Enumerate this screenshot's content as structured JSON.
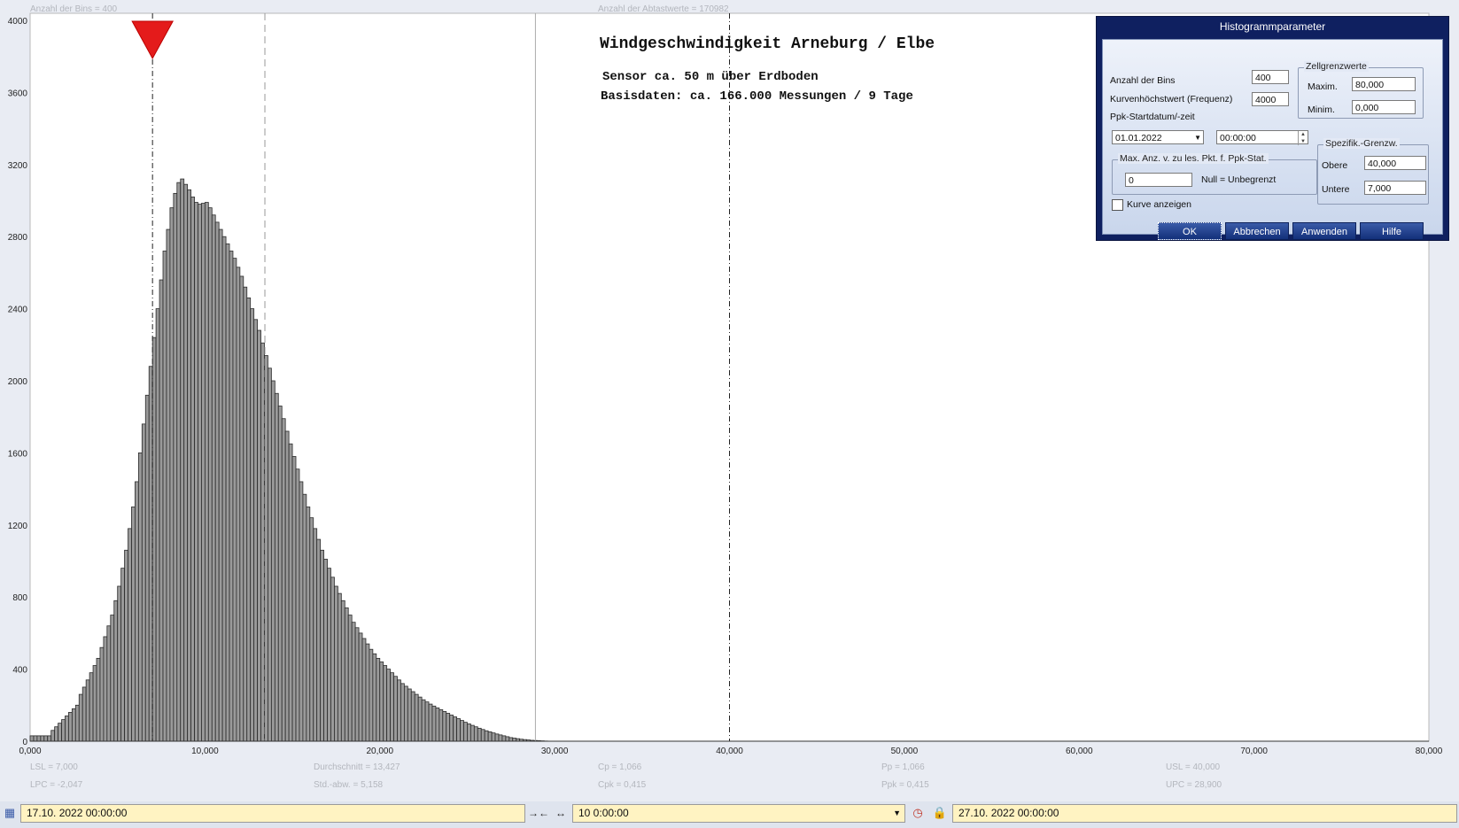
{
  "chart_data": {
    "type": "bar",
    "x_range": [
      0,
      80
    ],
    "ylim": [
      0,
      4000
    ],
    "x_ticks": [
      "0,000",
      "10,000",
      "20,000",
      "30,000",
      "40,000",
      "50,000",
      "60,000",
      "70,000",
      "80,000"
    ],
    "y_ticks": [
      "0",
      "400",
      "800",
      "1200",
      "1600",
      "2000",
      "2400",
      "2800",
      "3200",
      "3600",
      "4000"
    ],
    "bin_width": 0.2,
    "bin_start": 0,
    "values": [
      30,
      30,
      30,
      30,
      30,
      30,
      60,
      80,
      100,
      120,
      140,
      160,
      180,
      200,
      260,
      300,
      340,
      380,
      420,
      460,
      520,
      580,
      640,
      700,
      780,
      860,
      960,
      1060,
      1180,
      1300,
      1440,
      1600,
      1760,
      1920,
      2080,
      2240,
      2400,
      2560,
      2720,
      2840,
      2960,
      3040,
      3100,
      3120,
      3090,
      3060,
      3020,
      2990,
      2980,
      2985,
      2990,
      2960,
      2920,
      2880,
      2840,
      2800,
      2760,
      2720,
      2680,
      2630,
      2580,
      2520,
      2460,
      2400,
      2340,
      2280,
      2210,
      2140,
      2070,
      2000,
      1930,
      1860,
      1790,
      1720,
      1650,
      1580,
      1510,
      1440,
      1370,
      1300,
      1240,
      1180,
      1120,
      1060,
      1010,
      960,
      910,
      860,
      820,
      780,
      740,
      700,
      660,
      630,
      600,
      570,
      540,
      510,
      485,
      460,
      440,
      420,
      400,
      380,
      360,
      340,
      320,
      305,
      290,
      275,
      260,
      245,
      230,
      218,
      206,
      195,
      185,
      175,
      165,
      155,
      145,
      135,
      125,
      115,
      105,
      96,
      88,
      80,
      72,
      65,
      58,
      52,
      46,
      40,
      35,
      30,
      25,
      20,
      17,
      14,
      11,
      9,
      7,
      5,
      4,
      3,
      2,
      1
    ],
    "lsl": 7.0,
    "usl": 40.0,
    "mean": 13.427,
    "upc": 28.9,
    "grid": false
  },
  "top_stats": {
    "bins": "Anzahl der Bins =   400",
    "samples": "Anzahl der Abtastwerte = 170982"
  },
  "annotation": {
    "title": "Windgeschwindigkeit  Arneburg / Elbe",
    "line1": "Sensor ca. 50 m über Erdboden",
    "line2": "Basisdaten:  ca. 166.000 Messungen / 9 Tage"
  },
  "bottom_stats": {
    "lsl": "LSL = 7,000",
    "lpc": "LPC = -2,047",
    "mean": "Durchschnitt  = 13,427",
    "std": "Std.-abw.  = 5,158",
    "cp": "Cp  = 1,066",
    "cpk": "Cpk = 0,415",
    "pp": "Pp  = 1,066",
    "ppk": "Ppk = 0,415",
    "usl": "USL = 40,000",
    "upc": "UPC = 28,900"
  },
  "dialog": {
    "title": "Histogrammparameter",
    "bins_label": "Anzahl der Bins",
    "bins_value": "400",
    "curve_max_label": "Kurvenhöchstwert (Frequenz)",
    "curve_max_value": "4000",
    "ppk_start_label": "Ppk-Startdatum/-zeit",
    "start_date": "01.01.2022",
    "start_time": "00:00:00",
    "cell_limits_title": "Zellgrenzwerte",
    "max_label": "Maxim.",
    "max_value": "80,000",
    "min_label": "Minim.",
    "min_value": "0,000",
    "maxpts_title": "Max. Anz. v. zu les. Pkt. f. Ppk-Stat.",
    "maxpts_value": "0",
    "maxpts_hint": "Null = Unbegrenzt",
    "spec_title": "Spezifik.-Grenzw.",
    "upper_label": "Obere",
    "upper_value": "40,000",
    "lower_label": "Untere",
    "lower_value": "7,000",
    "show_curve_label": "Kurve anzeigen",
    "ok": "OK",
    "cancel": "Abbrechen",
    "apply": "Anwenden",
    "help": "Hilfe"
  },
  "bottom_bar": {
    "start": "17.10. 2022   00:00:00",
    "duration": "10  0:00:00",
    "end": "27.10. 2022   00:00:00"
  }
}
